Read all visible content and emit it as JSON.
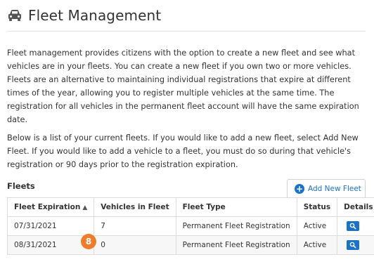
{
  "header": {
    "title": "Fleet Management",
    "icon": "car-icon"
  },
  "intro": {
    "paragraph1": "Fleet management provides citizens with the option to create a new fleet and see what vehicles are in your fleets. You can create a new fleet if you own two or more vehicles. Fleets are an alternative to maintaining individual registrations that expire at different times of the year, allowing you to register multiple vehicles at the same time. The registration for all vehicles in the permanent fleet account will have the same expiration date.",
    "paragraph2": "Below is a list of your current fleets. If you would like to add a new fleet, select Add New Fleet. If you would like to add a vehicle to a fleet, you must do so during that vehicle's registration or 90 days prior to the registration expiration."
  },
  "fleets": {
    "section_label": "Fleets",
    "add_button_label": "Add New Fleet",
    "columns": [
      "Fleet Expiration",
      "Vehicles in Fleet",
      "Fleet Type",
      "Status",
      "Details"
    ],
    "rows": [
      {
        "expiration": "07/31/2021",
        "vehicles": "7",
        "type": "Permanent Fleet Registration",
        "status": "Active"
      },
      {
        "expiration": "08/31/2021",
        "vehicles": "0",
        "type": "Permanent Fleet Registration",
        "status": "Active"
      }
    ]
  },
  "annotation": {
    "step_number": "8"
  },
  "colors": {
    "accent": "#1a73c6",
    "badge": "#ee7d2d"
  }
}
